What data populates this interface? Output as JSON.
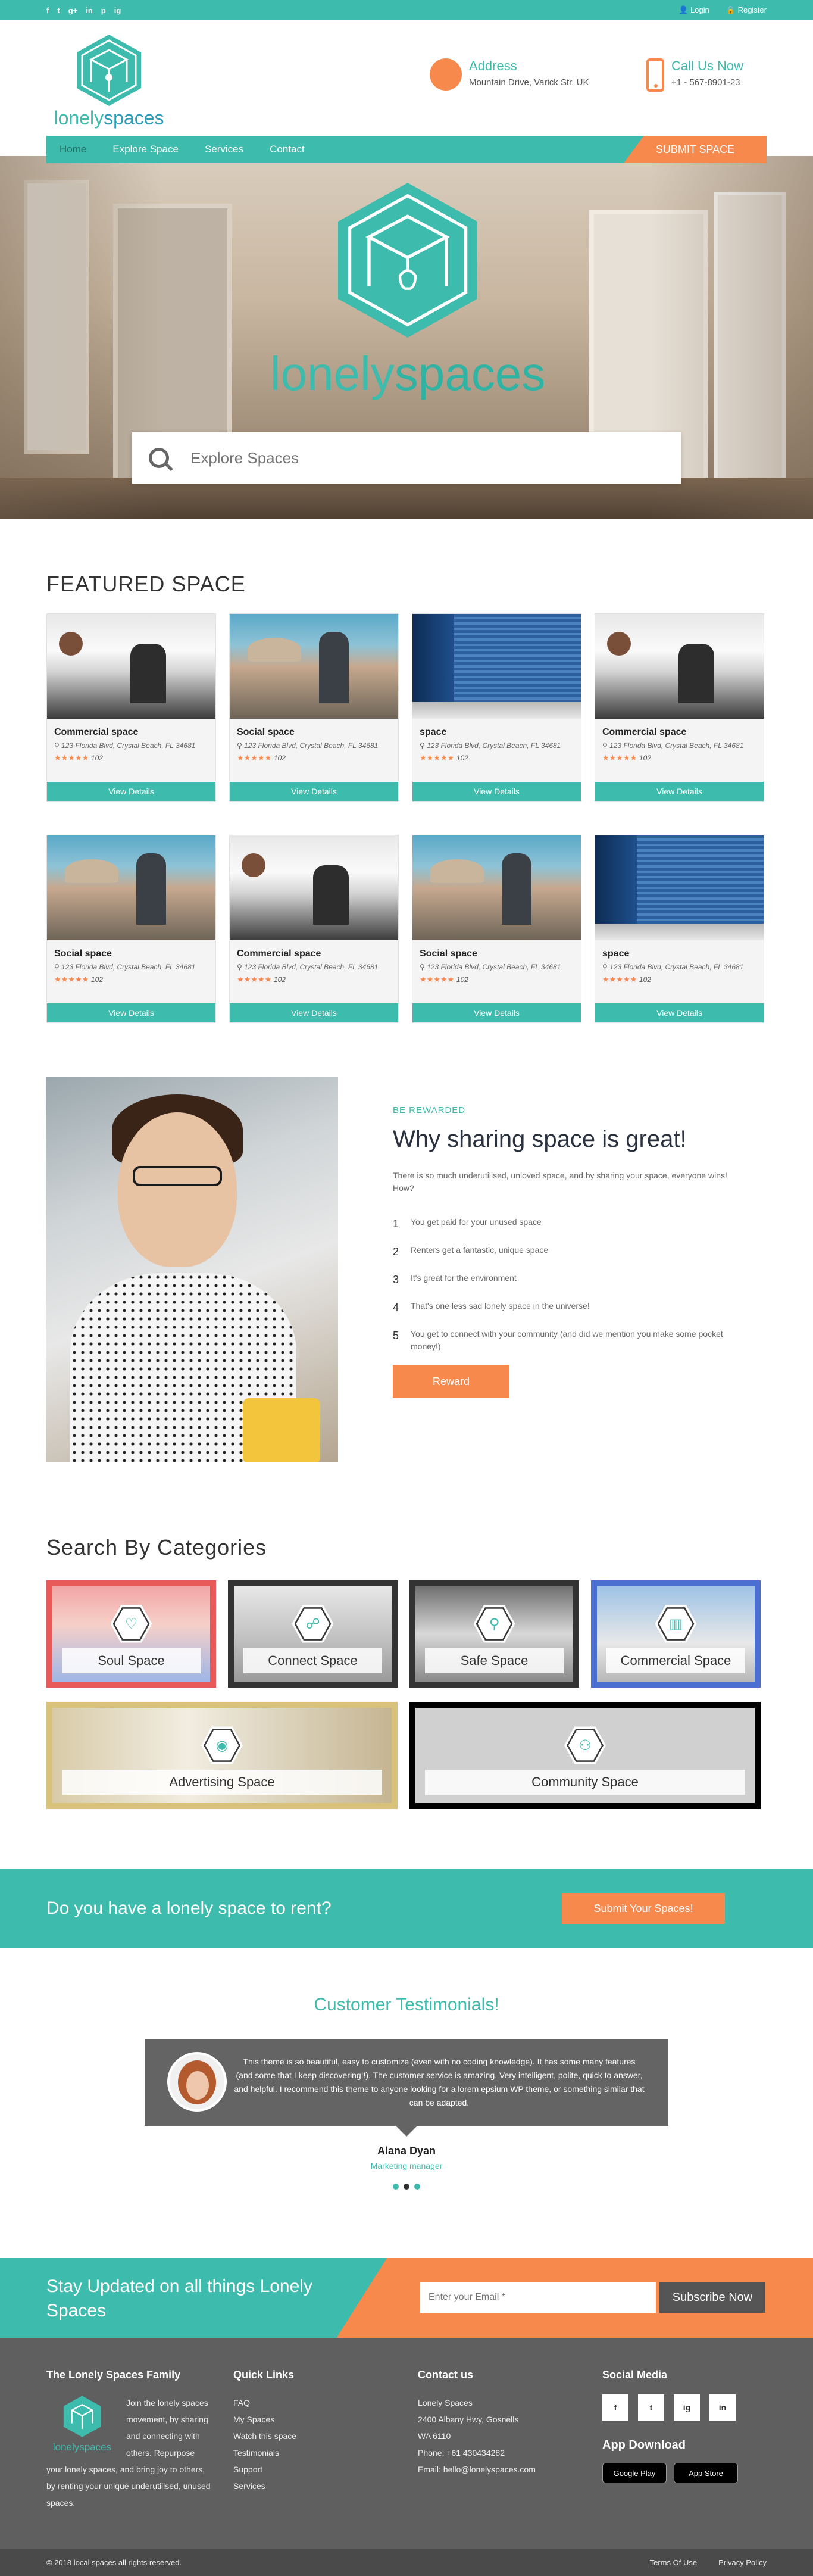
{
  "colors": {
    "teal": "#3dbbac",
    "orange": "#f7894d",
    "dark": "#5f5f5f"
  },
  "topbar": {
    "social_icons": [
      "f",
      "t",
      "g+",
      "in",
      "p",
      "ig"
    ],
    "social_icon_names": [
      "facebook-icon",
      "twitter-icon",
      "google-plus-icon",
      "linkedin-icon",
      "pinterest-icon",
      "instagram-icon"
    ],
    "login": "Login",
    "register": "Register"
  },
  "header": {
    "logo_part1": "lonely",
    "logo_part2": "spaces",
    "address_title": "Address",
    "address_value": "Mountain Drive, Varick Str. UK",
    "call_title": "Call Us Now",
    "call_value": "+1 - 567-8901-23"
  },
  "nav": {
    "items": [
      "Home",
      "Explore Space",
      "Services",
      "Contact"
    ],
    "submit": "SUBMIT SPACE"
  },
  "hero": {
    "logo_part1": "lonely",
    "logo_part2": "spaces",
    "search_placeholder": "Explore Spaces"
  },
  "featured": {
    "title": "FEATURED SPACE",
    "cards": [
      {
        "name": "Commercial space",
        "address": "123 Florida Blvd, Crystal Beach, FL 34681",
        "stars": "★★★★★",
        "count": "102",
        "button": "View Details",
        "image": "office"
      },
      {
        "name": "Social space",
        "address": "123 Florida Blvd, Crystal Beach, FL 34681",
        "stars": "★★★★★",
        "count": "102",
        "button": "View Details",
        "image": "social"
      },
      {
        "name": "space",
        "address": "123 Florida Blvd, Crystal Beach, FL 34681",
        "stars": "★★★★★",
        "count": "102",
        "button": "View Details",
        "image": "shutter"
      },
      {
        "name": "Commercial space",
        "address": "123 Florida Blvd, Crystal Beach, FL 34681",
        "stars": "★★★★★",
        "count": "102",
        "button": "View Details",
        "image": "office"
      },
      {
        "name": "Social space",
        "address": "123 Florida Blvd, Crystal Beach, FL 34681",
        "stars": "★★★★★",
        "count": "102",
        "button": "View Details",
        "image": "social"
      },
      {
        "name": "Commercial space",
        "address": "123 Florida Blvd, Crystal Beach, FL 34681",
        "stars": "★★★★★",
        "count": "102",
        "button": "View Details",
        "image": "office"
      },
      {
        "name": "Social space",
        "address": "123 Florida Blvd, Crystal Beach, FL 34681",
        "stars": "★★★★★",
        "count": "102",
        "button": "View Details",
        "image": "social"
      },
      {
        "name": "space",
        "address": "123 Florida Blvd, Crystal Beach, FL 34681",
        "stars": "★★★★★",
        "count": "102",
        "button": "View Details",
        "image": "shutter"
      }
    ]
  },
  "why": {
    "kicker": "BE REWARDED",
    "title": "Why sharing space is great!",
    "lead": "There is so much underutilised, unloved space, and by sharing your space, everyone wins! How?",
    "items": [
      {
        "n": "1",
        "text": "You get paid for your unused space"
      },
      {
        "n": "2",
        "text": "Renters get a fantastic, unique space"
      },
      {
        "n": "3",
        "text": "It's great for the environment"
      },
      {
        "n": "4",
        "text": "That's one less sad lonely space in the universe!"
      },
      {
        "n": "5",
        "text": "You get to connect with your community (and did we mention you make some pocket money!)"
      }
    ],
    "button": "Reward"
  },
  "categories": {
    "title": "Search By Categories",
    "row1": [
      {
        "label": "Soul Space",
        "icon": "♡",
        "icon_name": "heart-icon"
      },
      {
        "label": "Connect Space",
        "icon": "☍",
        "icon_name": "network-icon"
      },
      {
        "label": "Safe Space",
        "icon": "⚲",
        "icon_name": "tools-icon"
      },
      {
        "label": "Commercial Space",
        "icon": "▥",
        "icon_name": "building-icon"
      }
    ],
    "row2": [
      {
        "label": "Advertising Space",
        "icon": "◉",
        "icon_name": "eye-icon"
      },
      {
        "label": "Community Space",
        "icon": "⚇",
        "icon_name": "people-icon"
      }
    ]
  },
  "cta": {
    "question": "Do you have a lonely space to rent?",
    "button": "Submit Your Spaces!"
  },
  "testimonials": {
    "title": "Customer Testimonials!",
    "quote": "This theme is so beautiful, easy to customize (even with no coding knowledge). It has some many features (and some that I keep discovering!!). The customer service is amazing. Very intelligent, polite, quick to answer, and helpful. I recommend this theme to anyone looking for a lorem epsium WP theme, or something similar that can be adapted.",
    "name": "Alana Dyan",
    "role": "Marketing manager"
  },
  "newsletter": {
    "title": "Stay Updated on all things Lonely Spaces",
    "placeholder": "Enter your Email *",
    "button": "Subscribe Now"
  },
  "footer": {
    "family_title": "The Lonely Spaces Family",
    "family_text": "Join the lonely spaces movement, by sharing and connecting with others. Repurpose your lonely spaces, and bring joy to others, by renting your unique underutilised, unused spaces.",
    "quick_title": "Quick Links",
    "quick_links": [
      "FAQ",
      "My Spaces",
      "Watch this space",
      "Testimonials",
      "Support",
      "Services"
    ],
    "contact_title": "Contact us",
    "contact_lines": [
      "Lonely Spaces",
      "2400 Albany Hwy, Gosnells",
      "WA 6110",
      "Phone: +61 430434282",
      "Email: hello@lonelyspaces.com"
    ],
    "social_title": "Social Media",
    "social_icons": [
      "f",
      "t",
      "ig",
      "in"
    ],
    "social_icon_names": [
      "facebook-icon",
      "twitter-icon",
      "instagram-icon",
      "linkedin-icon"
    ],
    "app_title": "App Download",
    "stores": [
      "Google Play",
      "App Store"
    ],
    "copyright": "© 2018 local spaces all rights reserved.",
    "bottom_links": [
      "Terms Of Use",
      "Privacy Policy"
    ]
  }
}
